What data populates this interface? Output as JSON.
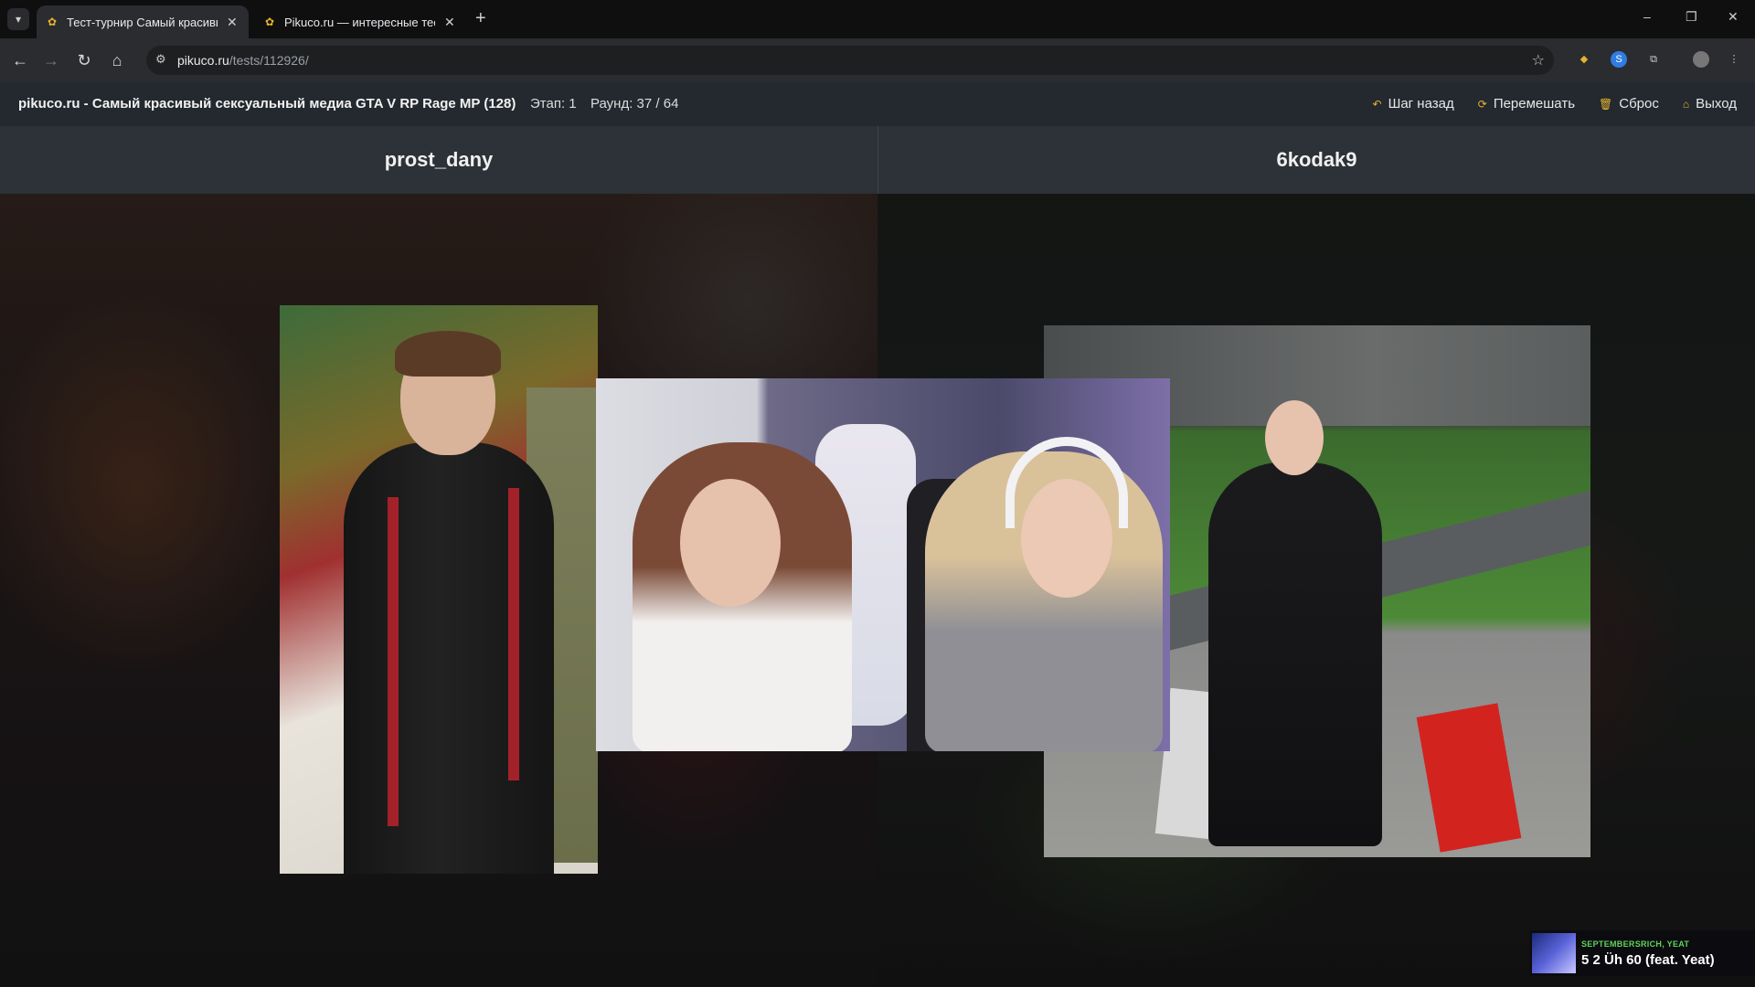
{
  "browser": {
    "tabs": [
      {
        "label": "Тест-турнир Самый красивый",
        "active": true
      },
      {
        "label": "Pikuco.ru — интересные тесты",
        "active": false
      }
    ],
    "tab_close": "✕",
    "new_tab": "+",
    "url_host": "pikuco.ru",
    "url_path": "/tests/112926/",
    "window_controls": {
      "minimize": "–",
      "restore": "❐",
      "close": "✕"
    }
  },
  "site": {
    "title": "pikuco.ru - Самый красивый сексуальный медиа GTA V RP Rage MP (128)",
    "stage": "Этап: 1",
    "round": "Раунд: 37 / 64",
    "actions": [
      {
        "icon": "undo-icon",
        "glyph": "↶",
        "label": "Шаг назад"
      },
      {
        "icon": "shuffle-icon",
        "glyph": "⟳",
        "label": "Перемешать"
      },
      {
        "icon": "trash-icon",
        "glyph": "🗑",
        "label": "Сброс"
      },
      {
        "icon": "home-icon",
        "glyph": "⌂",
        "label": "Выход"
      }
    ]
  },
  "contestants": {
    "left": {
      "name": "prost_dany"
    },
    "right": {
      "name": "6kodak9"
    }
  },
  "now_playing": {
    "artist": "SEPTEMBERSRICH, YEAT",
    "track": "5 2 Üh 60 (feat. Yeat)"
  },
  "colors": {
    "accent": "#e6b32e",
    "header_bg": "#24292f",
    "namebar_bg": "#2c3237",
    "now_playing_artist": "#5fd35a"
  }
}
